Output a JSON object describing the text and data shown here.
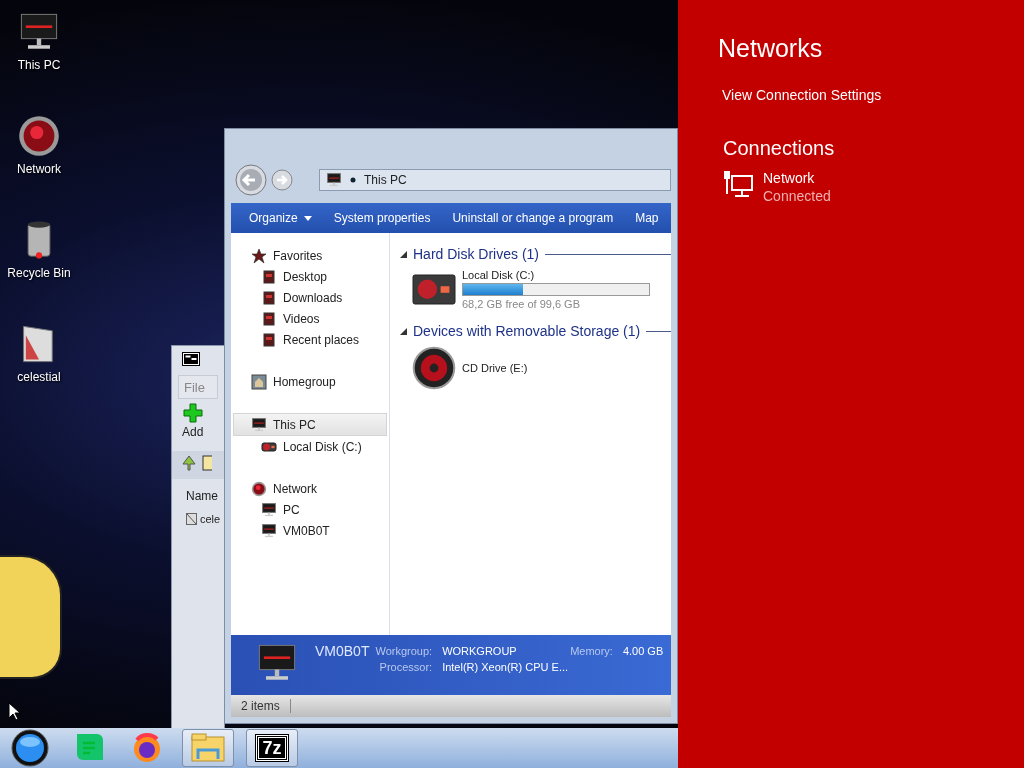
{
  "desktop_icons": [
    {
      "label": "This PC",
      "kind": "computer"
    },
    {
      "label": "Network",
      "kind": "network"
    },
    {
      "label": "Recycle Bin",
      "kind": "bin"
    },
    {
      "label": "celestial",
      "kind": "file"
    }
  ],
  "archive_window": {
    "menu": [
      "File"
    ],
    "toolbar": [
      {
        "label": "Add"
      }
    ],
    "column": "Name",
    "files": [
      "cele"
    ]
  },
  "explorer": {
    "address": "This PC",
    "commands": [
      {
        "label": "Organize",
        "dropdown": true
      },
      {
        "label": "System properties",
        "dropdown": false
      },
      {
        "label": "Uninstall or change a program",
        "dropdown": false
      },
      {
        "label": "Map",
        "dropdown": false
      }
    ],
    "nav": [
      {
        "label": "Favorites",
        "kind": "star",
        "selected": false,
        "children": [
          {
            "label": "Desktop",
            "kind": "folder",
            "selected": false
          },
          {
            "label": "Downloads",
            "kind": "folder",
            "selected": false
          },
          {
            "label": "Videos",
            "kind": "folder",
            "selected": false
          },
          {
            "label": "Recent places",
            "kind": "folder",
            "selected": false
          }
        ]
      },
      {
        "label": "Homegroup",
        "kind": "home",
        "selected": false
      },
      {
        "label": "This PC",
        "kind": "computer",
        "selected": true,
        "children": [
          {
            "label": "Local Disk (C:)",
            "kind": "disk",
            "selected": false
          }
        ]
      },
      {
        "label": "Network",
        "kind": "network",
        "selected": false,
        "children": [
          {
            "label": "PC",
            "kind": "computer",
            "selected": false
          },
          {
            "label": "VM0B0T",
            "kind": "computer",
            "selected": false
          }
        ]
      }
    ],
    "sections": [
      {
        "title": "Hard Disk Drives (1)",
        "items": [
          {
            "name": "Local Disk (C:)",
            "kind": "disk",
            "level": 0.32,
            "info": "68,2 GB free of 99,6 GB"
          }
        ]
      },
      {
        "title": "Devices with Removable Storage (1)",
        "items": [
          {
            "name": "CD Drive (E:)",
            "kind": "cd"
          }
        ]
      }
    ],
    "details": {
      "name": "VM0B0T",
      "fields": [
        {
          "label": "Workgroup:",
          "value": "WORKGROUP"
        },
        {
          "label": "Memory:",
          "value": "4.00 GB"
        },
        {
          "label": "Processor:",
          "value": "Intel(R) Xeon(R) CPU E..."
        }
      ]
    },
    "status": "2 items"
  },
  "taskbar": [
    {
      "kind": "start",
      "running": false
    },
    {
      "kind": "chat",
      "running": false
    },
    {
      "kind": "browser",
      "running": false
    },
    {
      "kind": "explorer",
      "running": true
    },
    {
      "kind": "archive",
      "running": true,
      "label": "7z"
    }
  ],
  "network_panel": {
    "title": "Networks",
    "link": "View Connection Settings",
    "section": "Connections",
    "connections": [
      {
        "name": "Network",
        "status": "Connected"
      }
    ]
  }
}
